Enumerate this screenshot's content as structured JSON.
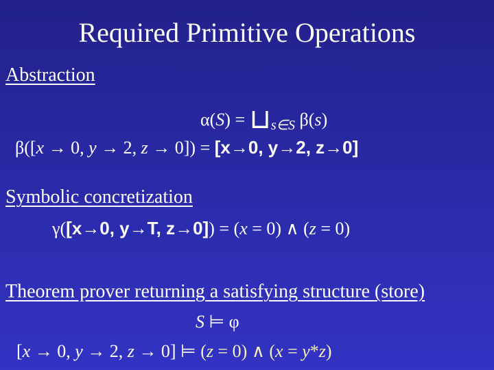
{
  "slide": {
    "title": "Required Primitive Operations",
    "background_colors": [
      "#22218a",
      "#3333c4"
    ],
    "highlight_color": "#f5f0b8"
  },
  "sections": [
    {
      "heading": "Abstraction",
      "formulas": [
        {
          "text": "α(S) = ⊔_{s∈S} β(s)"
        },
        {
          "lhs": "β([x → 0, y → 2, z → 0]) =",
          "rhs": "[x→0, y→2, z→0]"
        }
      ]
    },
    {
      "heading": "Symbolic concretization",
      "formulas": [
        {
          "lhs": "γ(",
          "store": "[x→0, y→T, z→0]",
          "rhs": ") = (x = 0) ∧ (z = 0)"
        }
      ]
    },
    {
      "heading": "Theorem prover returning a satisfying structure (store)",
      "formulas": [
        {
          "text": "S ⊨ φ"
        },
        {
          "lhs": "[x → 0, y → 2, z → 0] ⊨",
          "rhs": "(z = 0) ∧ (x = y*z)"
        }
      ]
    }
  ]
}
